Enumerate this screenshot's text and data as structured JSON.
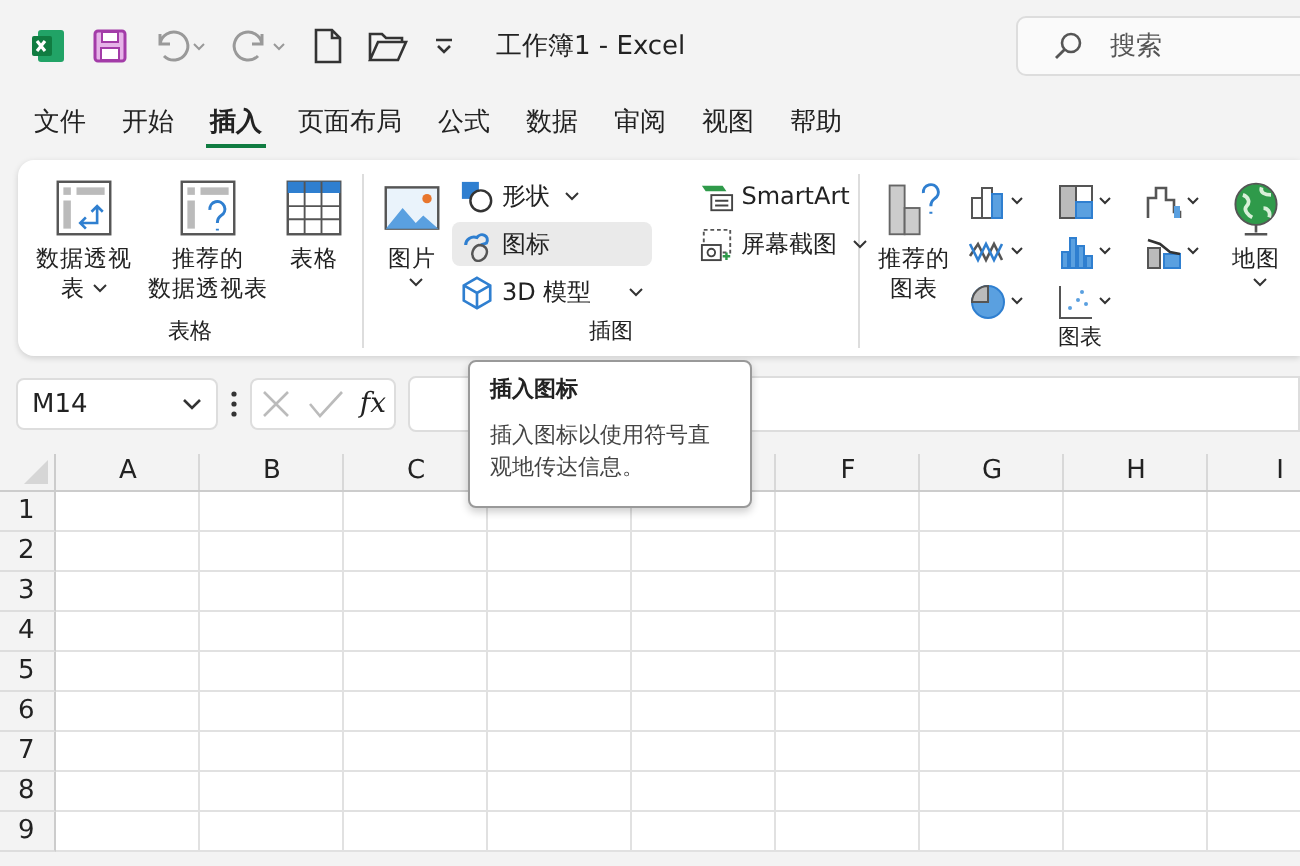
{
  "window": {
    "title": "工作簿1  -  Excel"
  },
  "search": {
    "placeholder": "搜索"
  },
  "tabs": [
    {
      "label": "文件",
      "selected": false
    },
    {
      "label": "开始",
      "selected": false
    },
    {
      "label": "插入",
      "selected": true
    },
    {
      "label": "页面布局",
      "selected": false
    },
    {
      "label": "公式",
      "selected": false
    },
    {
      "label": "数据",
      "selected": false
    },
    {
      "label": "审阅",
      "selected": false
    },
    {
      "label": "视图",
      "selected": false
    },
    {
      "label": "帮助",
      "selected": false
    }
  ],
  "ribbon": {
    "groups": [
      {
        "label": "表格",
        "items": [
          {
            "kind": "large",
            "lines": [
              "数据透视",
              "表"
            ],
            "dropdown": true,
            "highlighted": false
          },
          {
            "kind": "large",
            "lines": [
              "推荐的",
              "数据透视表"
            ],
            "dropdown": false,
            "highlighted": false
          },
          {
            "kind": "large",
            "lines": [
              "表格"
            ],
            "dropdown": false,
            "highlighted": false
          }
        ]
      },
      {
        "label": "插图",
        "items": [
          {
            "kind": "large",
            "lines": [
              "图片"
            ],
            "dropdown": true,
            "highlighted": false
          },
          {
            "kind": "column",
            "children": [
              {
                "label": "形状",
                "dropdown": true,
                "highlighted": false
              },
              {
                "label": "图标",
                "dropdown": false,
                "highlighted": true
              },
              {
                "label": "3D 模型",
                "dropdown": true,
                "highlighted": false
              }
            ]
          },
          {
            "kind": "column",
            "children": [
              {
                "label": "SmartArt",
                "dropdown": false,
                "highlighted": false
              },
              {
                "label": "屏幕截图",
                "dropdown": true,
                "highlighted": false
              }
            ]
          }
        ]
      },
      {
        "label": "图表",
        "items": [
          {
            "kind": "large",
            "lines": [
              "推荐的",
              "图表"
            ],
            "dropdown": false,
            "highlighted": false
          },
          {
            "kind": "charts"
          },
          {
            "kind": "large",
            "lines": [
              "地图"
            ],
            "dropdown": true,
            "highlighted": false
          }
        ]
      }
    ]
  },
  "formula_bar": {
    "name_box": "M14",
    "fx_label": "fx"
  },
  "tooltip": {
    "title": "插入图标",
    "body": "插入图标以使用符号直观地传达信息。"
  },
  "sheet": {
    "columns": [
      {
        "label": "A"
      },
      {
        "label": "B"
      },
      {
        "label": "C"
      },
      {},
      {},
      {
        "label": "F"
      },
      {
        "label": "G"
      },
      {
        "label": "H"
      },
      {
        "label": "I"
      }
    ],
    "rows": [
      "1",
      "2",
      "3",
      "4",
      "5",
      "6",
      "7",
      "8",
      "9"
    ]
  }
}
